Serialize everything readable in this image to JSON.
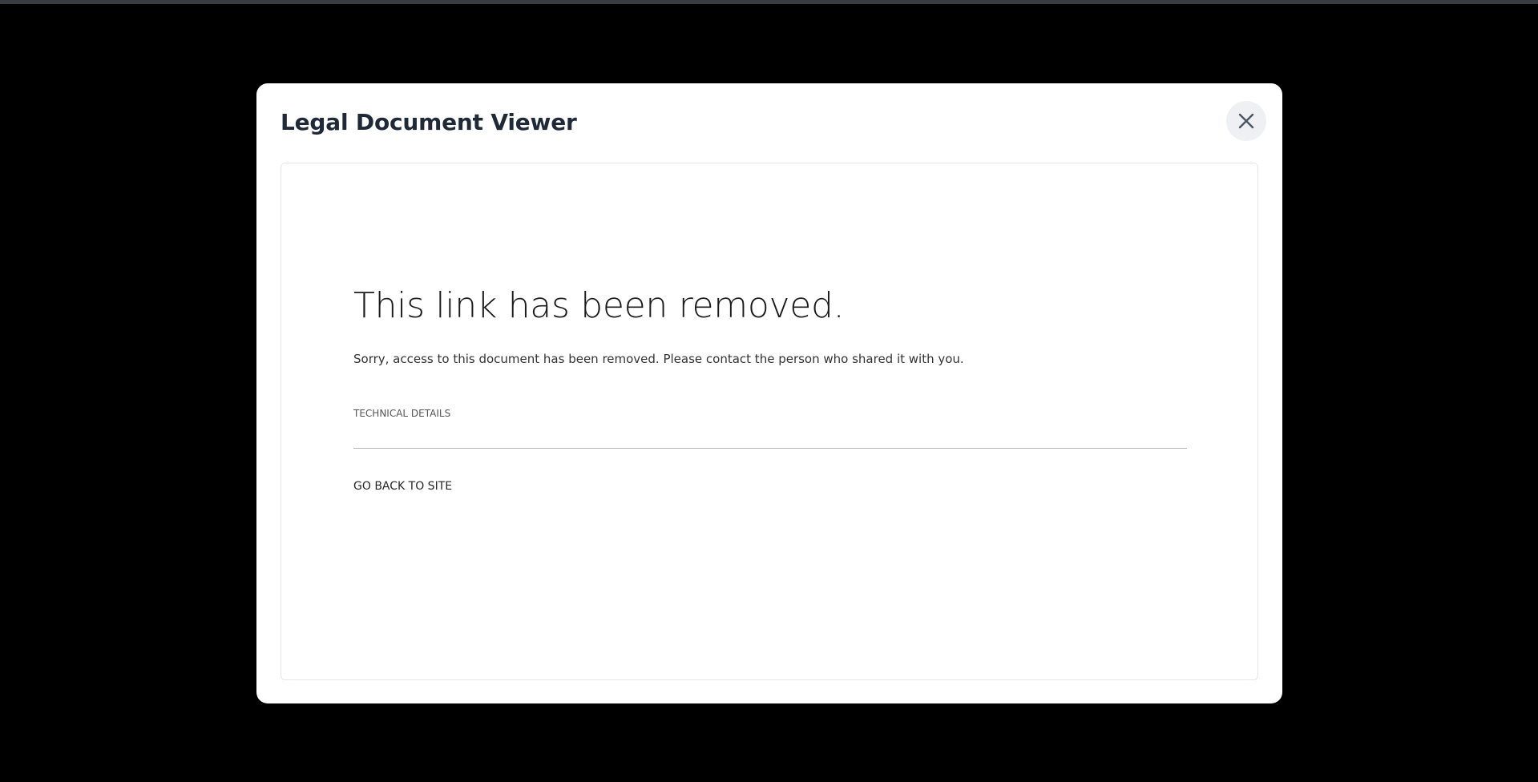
{
  "modal": {
    "title": "Legal Document Viewer",
    "close_icon": "close-icon"
  },
  "error": {
    "heading": "This link has been removed.",
    "message": "Sorry, access to this document has been removed. Please contact the person who shared it with you.",
    "technical_details_label": "TECHNICAL DETAILS",
    "back_link_label": "GO BACK TO SITE"
  },
  "colors": {
    "backdrop": "#000000",
    "modal_background": "#ffffff",
    "title_text": "#1f2937",
    "close_button_bg": "#eef0f3",
    "close_icon": "#4b5563"
  }
}
